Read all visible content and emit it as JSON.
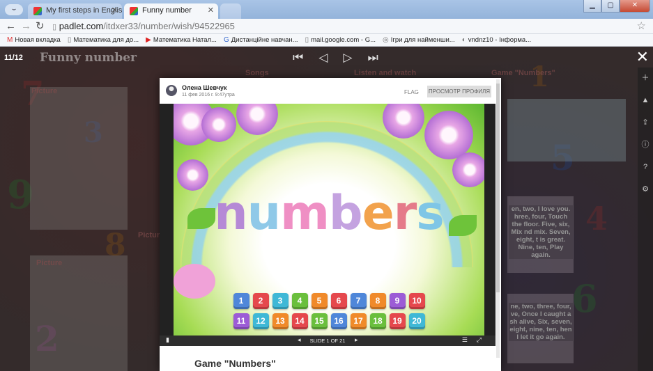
{
  "browser": {
    "tabs": [
      {
        "label": "My first steps in English",
        "active": false
      },
      {
        "label": "Funny number",
        "active": true
      }
    ],
    "url_host": "padlet.com",
    "url_path": "/itdxer33/number/wish/94522965",
    "bookmarks": [
      {
        "icon": "gmail-icon",
        "glyph": "M",
        "label": "Новая вкладка"
      },
      {
        "icon": "page-icon",
        "glyph": "▯",
        "label": "Математика для до..."
      },
      {
        "icon": "youtube-icon",
        "glyph": "▶",
        "label": "Математика Натал..."
      },
      {
        "icon": "google-icon",
        "glyph": "G",
        "label": "Дистанційне навчан..."
      },
      {
        "icon": "page-icon",
        "glyph": "▯",
        "label": "mail.google.com - G..."
      },
      {
        "icon": "game-icon",
        "glyph": "◎",
        "label": "Ігри для найменши..."
      },
      {
        "icon": "site-icon",
        "glyph": "◐",
        "label": "vndnz10 - Інформа..."
      }
    ]
  },
  "padlet": {
    "counter": "11/12",
    "board_title": "Funny number",
    "column_labels": {
      "picture_top": "Picture",
      "songs": "Songs",
      "listen": "Listen and watch",
      "game": "Game \"Numbers\"",
      "picture_left": "Picture",
      "picture_mid": "Picture"
    },
    "side_text_1": "en, two, I love you. hree, four, Touch the floor. Five, six, Mix nd mix. Seven, eight, t is great. Nine, ten, Play again.",
    "side_text_2": "ne, two, three, four, ve, Once I caught a sh alive, Six, seven, eight, nine, ten, hen I let it go again."
  },
  "modal": {
    "author": "Олена Шевчук",
    "date": "11 фев 2016 г. 9:47утра",
    "flag_label": "FLAG",
    "profile_label": "ПРОСМОТР ПРОФИЛЯ",
    "slide_label": "SLIDE 1 OF 21",
    "post_title": "Game \"Numbers\"",
    "word": [
      "n",
      "u",
      "m",
      "b",
      "e",
      "r",
      "s"
    ],
    "word_colors": [
      "#b589d6",
      "#8fc9e8",
      "#ef8fc4",
      "#c4a2e0",
      "#f2a24c",
      "#e57b8a",
      "#7fc6e6"
    ],
    "row1": [
      "1",
      "2",
      "3",
      "4",
      "5",
      "6",
      "7",
      "8",
      "9",
      "10"
    ],
    "row2": [
      "11",
      "12",
      "13",
      "14",
      "15",
      "16",
      "17",
      "18",
      "19",
      "20"
    ],
    "colors1": [
      "#4f87d9",
      "#e5484d",
      "#3fb8d6",
      "#6abf3d",
      "#f08a2a",
      "#e5484d",
      "#4f87d9",
      "#f08a2a",
      "#9c5cd6",
      "#e5484d"
    ],
    "colors2": [
      "#9c5cd6",
      "#3fb8d6",
      "#f08a2a",
      "#e5484d",
      "#6abf3d",
      "#4f87d9",
      "#f08a2a",
      "#6abf3d",
      "#e5484d",
      "#3fb8d6"
    ]
  }
}
